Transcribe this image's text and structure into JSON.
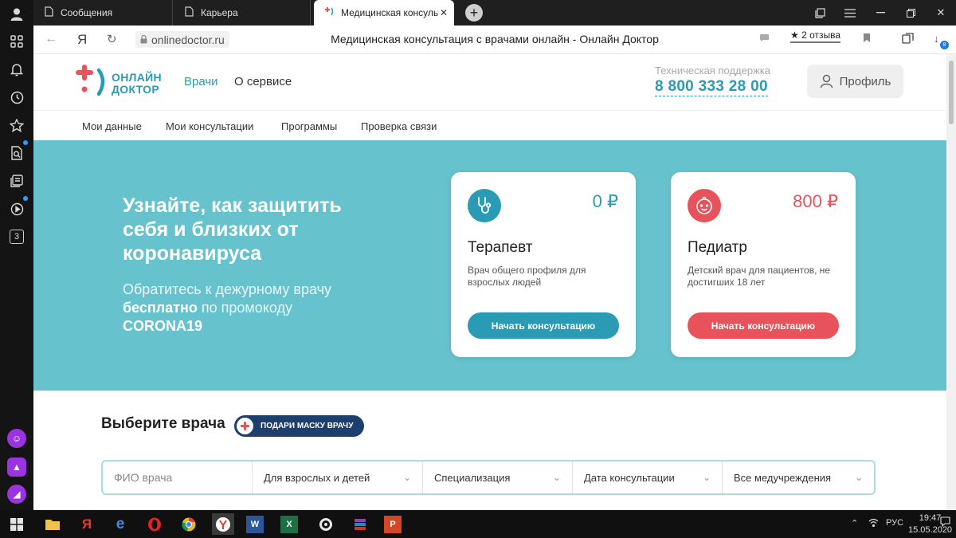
{
  "browser": {
    "tabs": [
      {
        "label": "Сообщения",
        "icon": "file-icon"
      },
      {
        "label": "Карьера",
        "icon": "file-icon"
      },
      {
        "label": "Медицинская консульт",
        "icon": "doctor-icon",
        "active": true
      }
    ],
    "url": "onlinedoctor.ru",
    "page_title": "Медицинская консультация с врачами онлайн - Онлайн Доктор",
    "reviews": "2 отзыва",
    "downloads_badge": "8"
  },
  "sidebar": {
    "badge": "3"
  },
  "site": {
    "logo_line1": "ОНЛАЙН",
    "logo_line2": "ДОКТОР",
    "nav": {
      "doctors": "Врачи",
      "about": "О сервисе"
    },
    "support_label": "Техническая поддержка",
    "phone": "8 800 333 28 00",
    "profile": "Профиль",
    "subnav": [
      "Мои данные",
      "Мои консультации",
      "Программы",
      "Проверка связи"
    ],
    "colors": {
      "teal": "#2a9bb4",
      "hero": "#66c2cd",
      "red": "#e8525a",
      "navy": "#1c3f6e"
    }
  },
  "hero": {
    "headline": "Узнайте, как защитить себя и близких от коронавируса",
    "sub_before": "Обратитесь к дежурному врачу ",
    "sub_bold": "бесплатно",
    "sub_after": " по промокоду ",
    "promo": "CORONA19"
  },
  "cards": [
    {
      "icon": "stethoscope-icon",
      "price": "0 ₽",
      "title": "Терапевт",
      "desc": "Врач общего профиля для взрослых людей",
      "button": "Начать консультацию"
    },
    {
      "icon": "baby-face-icon",
      "price": "800 ₽",
      "title": "Педиатр",
      "desc": "Детский врач для пациентов, не достигших 18 лет",
      "button": "Начать консультацию"
    }
  ],
  "choose": {
    "title": "Выберите врача",
    "mask_button": "ПОДАРИ МАСКУ ВРАЧУ"
  },
  "filters": {
    "name_placeholder": "ФИО врача",
    "age": "Для взрослых и детей",
    "specialization": "Специализация",
    "date": "Дата консультации",
    "clinics": "Все медучреждения"
  },
  "taskbar": {
    "lang": "РУС",
    "time": "19:47",
    "date": "15.05.2020"
  }
}
